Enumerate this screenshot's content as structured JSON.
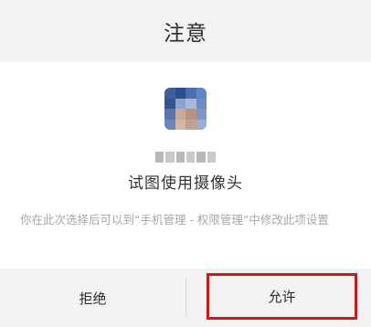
{
  "dialog": {
    "title": "注意",
    "request_text": "试图使用摄像头",
    "hint_text": "你在此次选择后可以到“手机管理 - 权限管理”中修改此项设置",
    "buttons": {
      "deny": "拒绝",
      "allow": "允许"
    },
    "highlight_color": "#c51b1b",
    "app_icon_colors": [
      "#3d5f9a",
      "#2c4f8c",
      "#4a6fb0",
      "#5d86c6",
      "#34558f",
      "#8aa4cf",
      "#a8b8d6",
      "#6b8cc4",
      "#5776ae",
      "#c9a99a",
      "#b99384",
      "#7b97c8",
      "#6d86b8",
      "#d2b7a8",
      "#c29f90",
      "#9aaed4"
    ]
  }
}
